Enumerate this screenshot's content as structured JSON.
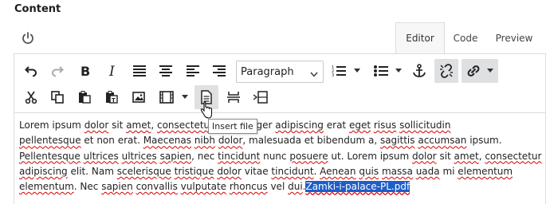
{
  "section": {
    "title": "Content"
  },
  "tabs": [
    {
      "label": "Editor",
      "active": true
    },
    {
      "label": "Code",
      "active": false
    },
    {
      "label": "Preview",
      "active": false
    }
  ],
  "toolbar": {
    "format_select": {
      "value": "Paragraph"
    },
    "tooltip": "Insert file",
    "icons": [
      "undo-icon",
      "redo-icon",
      "bold-icon",
      "italic-icon",
      "align-justify-icon",
      "align-center-icon",
      "align-left-icon",
      "ordered-list-icon",
      "bullet-list-icon",
      "anchor-icon",
      "unlink-icon",
      "link-icon",
      "cut-icon",
      "copy-icon",
      "paste-icon",
      "paste-text-icon",
      "image-icon",
      "media-icon",
      "insert-file-icon",
      "page-break-icon",
      "horizontal-rule-icon"
    ]
  },
  "body": {
    "lines": [
      [
        {
          "t": "Lorem ipsum "
        },
        {
          "t": "dolor",
          "s": 1
        },
        {
          "t": " sit "
        },
        {
          "t": "amet",
          "s": 1
        },
        {
          "t": ", "
        },
        {
          "t": "consectetur",
          "s": 1
        },
        {
          "t": "                 elit. Integer "
        },
        {
          "t": "adipiscing",
          "s": 1
        },
        {
          "t": " erat "
        },
        {
          "t": "eget",
          "s": 1
        },
        {
          "t": " "
        },
        {
          "t": "risus",
          "s": 1
        },
        {
          "t": " "
        },
        {
          "t": "sollicitudin",
          "s": 1
        }
      ],
      [
        {
          "t": "pellentesque",
          "s": 1
        },
        {
          "t": " et non erat. "
        },
        {
          "t": "Maecenas",
          "s": 1
        },
        {
          "t": " "
        },
        {
          "t": "nibh",
          "s": 1
        },
        {
          "t": " "
        },
        {
          "t": "dolor",
          "s": 1
        },
        {
          "t": ", malesuada et bibendum a, "
        },
        {
          "t": "sagittis",
          "s": 1
        },
        {
          "t": " "
        },
        {
          "t": "accumsan",
          "s": 1
        },
        {
          "t": " ipsum."
        }
      ],
      [
        {
          "t": "Pellentesque",
          "s": 1
        },
        {
          "t": " "
        },
        {
          "t": "ultrices",
          "s": 1
        },
        {
          "t": " "
        },
        {
          "t": "ultrices",
          "s": 1
        },
        {
          "t": " "
        },
        {
          "t": "sapien",
          "s": 1
        },
        {
          "t": ", nec "
        },
        {
          "t": "tincidunt",
          "s": 1
        },
        {
          "t": " nunc "
        },
        {
          "t": "posuere",
          "s": 1
        },
        {
          "t": " ut. Lorem ipsum "
        },
        {
          "t": "dolor",
          "s": 1
        },
        {
          "t": " sit "
        },
        {
          "t": "amet",
          "s": 1
        },
        {
          "t": ", "
        },
        {
          "t": "consectetur",
          "s": 1
        }
      ],
      [
        {
          "t": "adipiscing",
          "s": 1
        },
        {
          "t": " elit. Nam "
        },
        {
          "t": "scelerisque",
          "s": 1
        },
        {
          "t": " "
        },
        {
          "t": "tristique",
          "s": 1
        },
        {
          "t": " "
        },
        {
          "t": "dolor",
          "s": 1
        },
        {
          "t": " vitae "
        },
        {
          "t": "tincidunt",
          "s": 1
        },
        {
          "t": ". "
        },
        {
          "t": "Aenean",
          "s": 1
        },
        {
          "t": " "
        },
        {
          "t": "quis",
          "s": 1
        },
        {
          "t": " "
        },
        {
          "t": "massa",
          "s": 1
        },
        {
          "t": " "
        },
        {
          "t": "uada",
          "s": 1
        },
        {
          "t": " mi "
        },
        {
          "t": "elementum",
          "s": 1
        }
      ],
      [
        {
          "t": "elementum",
          "s": 1
        },
        {
          "t": ". Nec "
        },
        {
          "t": "sapien",
          "s": 1
        },
        {
          "t": " "
        },
        {
          "t": "convallis",
          "s": 1
        },
        {
          "t": " "
        },
        {
          "t": "vulputate",
          "s": 1
        },
        {
          "t": " "
        },
        {
          "t": "rhoncus",
          "s": 1
        },
        {
          "t": " vel "
        },
        {
          "t": "dui",
          "s": 1
        },
        {
          "t": ".",
          "t2": ""
        },
        {
          "t": "Zamki-i-palace-PL.pdf",
          "h": 1
        }
      ]
    ]
  },
  "colors": {
    "selection": "#1e5ec8",
    "spell": "#d40000",
    "border": "#dddddd"
  }
}
